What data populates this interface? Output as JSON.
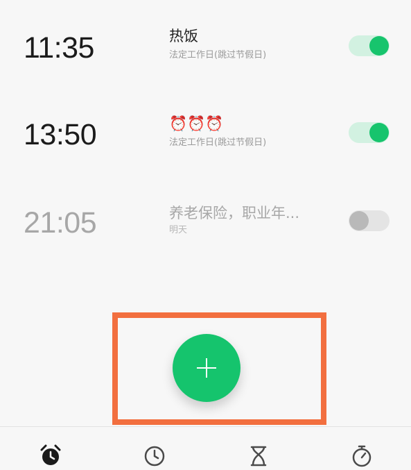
{
  "alarms": [
    {
      "time": "11:35",
      "title": "热饭",
      "repeat": "法定工作日(跳过节假日)",
      "enabled": true
    },
    {
      "time": "13:50",
      "title": "⏰⏰⏰",
      "repeat": "法定工作日(跳过节假日)",
      "enabled": true
    },
    {
      "time": "21:05",
      "title": "养老保险，职业年...",
      "repeat": "明天",
      "enabled": false
    }
  ],
  "colors": {
    "accent": "#15c46d",
    "toggle_on_track": "#d2f1e1",
    "toggle_off_track": "#e4e4e4",
    "highlight": "#f26f3f"
  },
  "fab": {
    "icon": "plus-icon"
  },
  "bottom_nav": {
    "tabs": [
      {
        "icon": "alarm-clock-icon",
        "active": true
      },
      {
        "icon": "world-clock-icon",
        "active": false
      },
      {
        "icon": "hourglass-timer-icon",
        "active": false
      },
      {
        "icon": "stopwatch-icon",
        "active": false
      }
    ]
  }
}
